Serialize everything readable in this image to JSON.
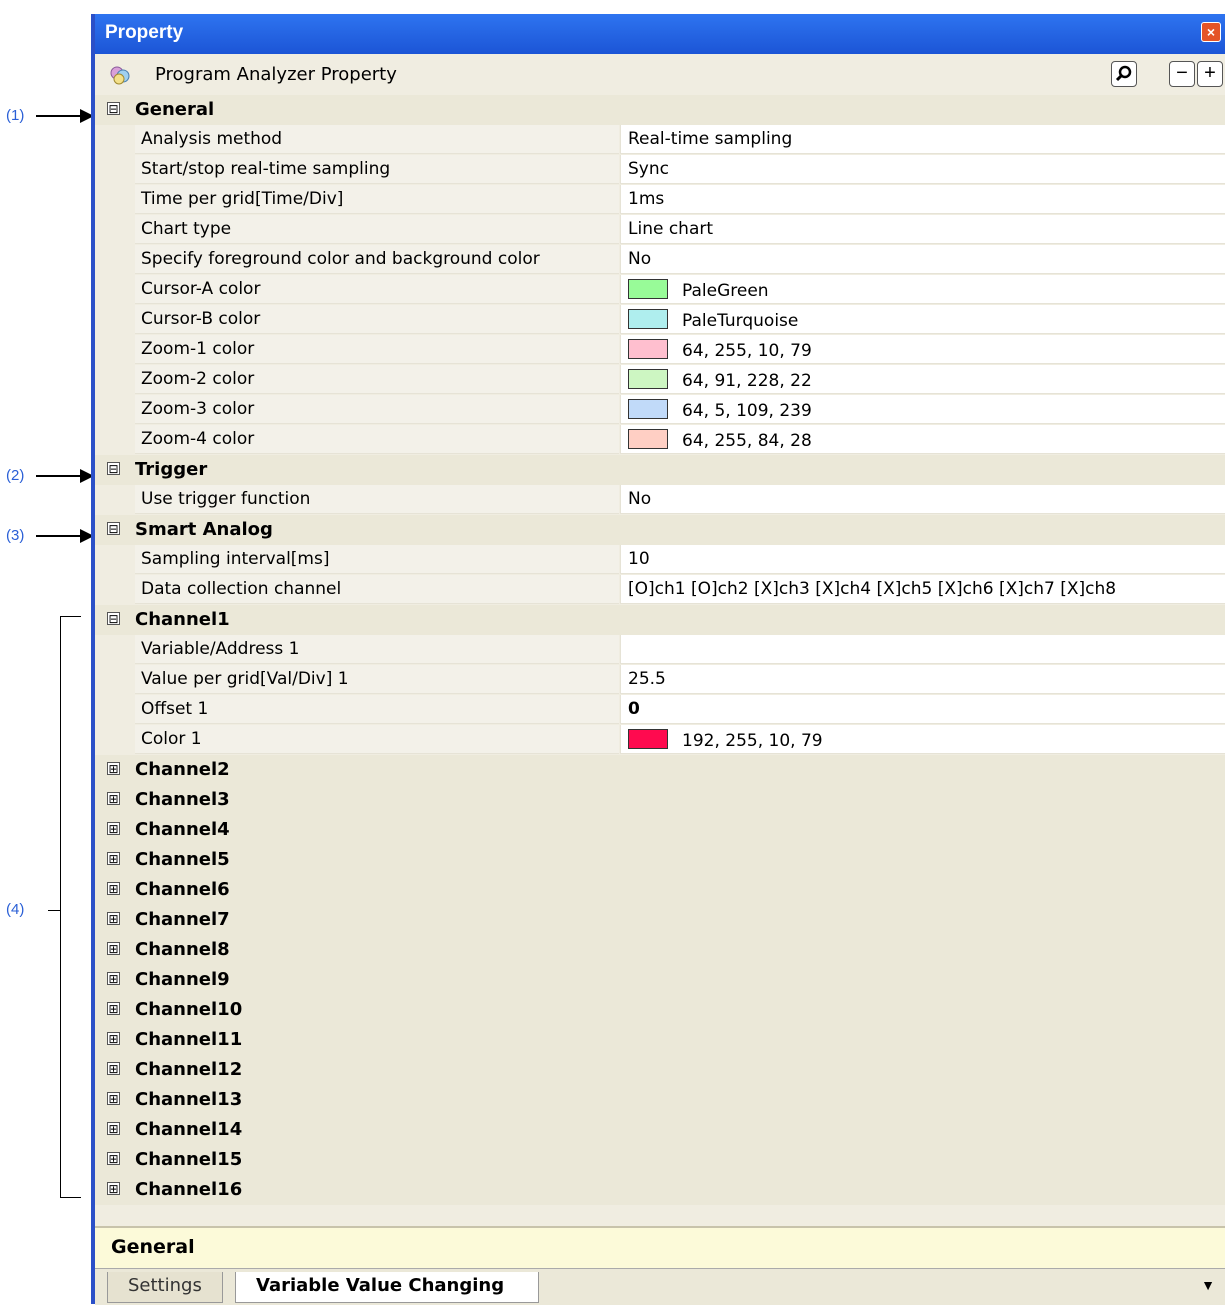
{
  "callouts": {
    "c1": "(1)",
    "c2": "(2)",
    "c3": "(3)",
    "c4": "(4)"
  },
  "window": {
    "title": "Property",
    "subtitle": "Program Analyzer Property"
  },
  "colors": {
    "title_bar": "#2e74f0",
    "window_border": "#2b50c8",
    "callout_text": "#2a5fd6",
    "close_button": "#e45428"
  },
  "grid": {
    "general": {
      "label": "General",
      "rows": [
        {
          "name": "Analysis method",
          "value": "Real-time sampling"
        },
        {
          "name": "Start/stop real-time sampling",
          "value": "Sync"
        },
        {
          "name": "Time per grid[Time/Div]",
          "value": "1ms"
        },
        {
          "name": "Chart type",
          "value": "Line chart"
        },
        {
          "name": "Specify foreground color and background color",
          "value": "No"
        },
        {
          "name": "Cursor-A color",
          "value": "PaleGreen",
          "swatch": "#98fb98"
        },
        {
          "name": "Cursor-B color",
          "value": "PaleTurquoise",
          "swatch": "#afeeee"
        },
        {
          "name": "Zoom-1 color",
          "value": "64, 255, 10, 79",
          "swatch": "#ffbfcf"
        },
        {
          "name": "Zoom-2 color",
          "value": "64, 91, 228, 22",
          "swatch": "#cdf6c2"
        },
        {
          "name": "Zoom-3 color",
          "value": "64, 5, 109, 239",
          "swatch": "#c1daf9"
        },
        {
          "name": "Zoom-4 color",
          "value": "64, 255, 84, 28",
          "swatch": "#ffcfc4"
        }
      ]
    },
    "trigger": {
      "label": "Trigger",
      "rows": [
        {
          "name": "Use trigger function",
          "value": "No"
        }
      ]
    },
    "smart_analog": {
      "label": "Smart Analog",
      "rows": [
        {
          "name": "Sampling interval[ms]",
          "value": "10"
        },
        {
          "name": "Data collection channel",
          "value": "[O]ch1 [O]ch2 [X]ch3 [X]ch4 [X]ch5 [X]ch6 [X]ch7 [X]ch8"
        }
      ]
    },
    "channel1": {
      "label": "Channel1",
      "rows": [
        {
          "name": "Variable/Address 1",
          "value": ""
        },
        {
          "name": "Value per grid[Val/Div] 1",
          "value": "25.5"
        },
        {
          "name": "Offset 1",
          "value": "0"
        },
        {
          "name": "Color 1",
          "value": "192, 255, 10, 79",
          "swatch": "#ff0a4f"
        }
      ]
    },
    "collapsed_channels": [
      "Channel2",
      "Channel3",
      "Channel4",
      "Channel5",
      "Channel6",
      "Channel7",
      "Channel8",
      "Channel9",
      "Channel10",
      "Channel11",
      "Channel12",
      "Channel13",
      "Channel14",
      "Channel15",
      "Channel16"
    ]
  },
  "description": {
    "title": "General"
  },
  "tabs": [
    {
      "label": "Settings",
      "active": false
    },
    {
      "label": "Variable Value Changing",
      "active": true
    }
  ],
  "icons": {
    "collapse": "⊟",
    "expand": "⊞",
    "search": "search-icon",
    "minus": "−",
    "plus": "+",
    "close": "×",
    "dropdown": "▼"
  }
}
